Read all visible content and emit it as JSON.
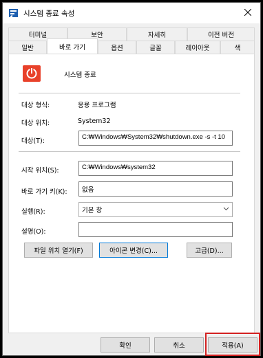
{
  "window": {
    "title": "시스템 종료 속성",
    "close_glyph": "✕"
  },
  "tabs": {
    "row1": [
      "터미널",
      "보안",
      "자세히",
      "이전 버전"
    ],
    "row2": [
      "일반",
      "바로 가기",
      "옵션",
      "글꼴",
      "레이아웃",
      "색"
    ],
    "active": "바로 가기"
  },
  "app": {
    "name": "시스템 종료",
    "icon": "power-icon",
    "icon_color": "#e8412a"
  },
  "info": {
    "target_type_label": "대상 형식:",
    "target_type_value": "응용 프로그램",
    "target_location_label": "대상 위치:",
    "target_location_value": "System32",
    "target_label": "대상(T):",
    "target_value": "C:₩Windows₩System32₩shutdown.exe -s -t 10"
  },
  "fields": {
    "start_in_label": "시작 위치(S):",
    "start_in_value": "C:₩Windows₩system32",
    "shortcut_key_label": "바로 가기 키(K):",
    "shortcut_key_value": "없음",
    "run_label": "실행(R):",
    "run_value": "기본 창",
    "comment_label": "설명(O):",
    "comment_value": ""
  },
  "actions": {
    "open_location": "파일 위치 열기(F)",
    "change_icon": "아이콘 변경(C)...",
    "advanced": "고급(D)..."
  },
  "footer": {
    "ok": "확인",
    "cancel": "취소",
    "apply": "적용(A)"
  },
  "colors": {
    "highlight": "#d32020",
    "focus_border": "#0078d7"
  }
}
